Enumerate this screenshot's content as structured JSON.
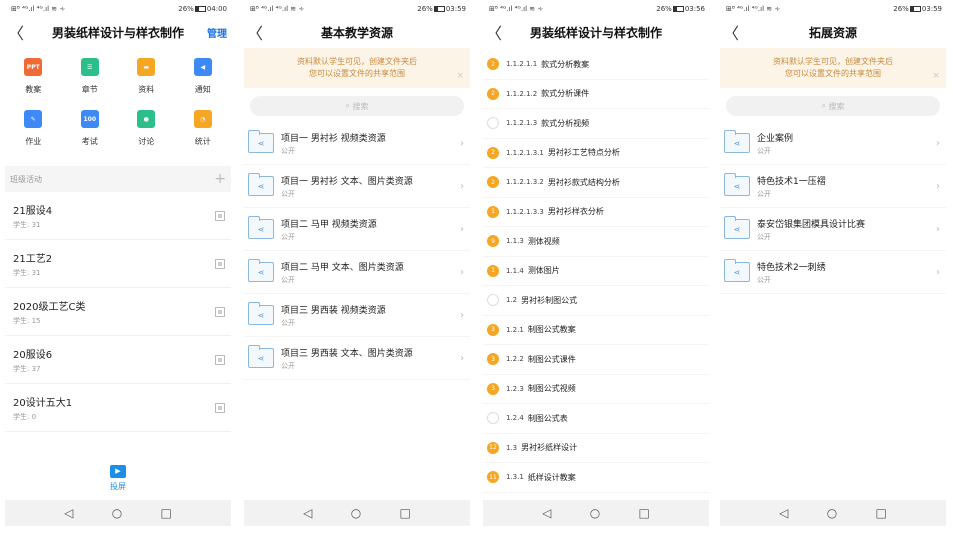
{
  "colors": {
    "accent": "#1a73e8",
    "orange": "#f5a623",
    "notice_text": "#c88a3c",
    "notice_bg": "#fdf4e8"
  },
  "status": {
    "p1": {
      "left": "⊞ᴮ ⁴ᴳ.ıl ⁴ᴳ.ıl ≋ ∻",
      "battery": "26%",
      "time": "04:00"
    },
    "p2": {
      "left": "⊞ᴮ ⁴ᴳ.ıl ⁴ᴳ.ıl ≋ ∻",
      "battery": "26%",
      "time": "03:59"
    },
    "p3": {
      "left": "⊞ᴮ ⁴ᴳ.ıl ⁴ᴳ.ıl ≋ ∻",
      "battery": "26%",
      "time": "03:56"
    },
    "p4": {
      "left": "⊞ᴮ ⁴ᴳ.ıl ⁴ᴳ.ıl ≋ ∻",
      "battery": "26%",
      "time": "03:59"
    }
  },
  "screen1": {
    "title": "男装纸样设计与样衣制作",
    "manage": "管理",
    "tools": [
      {
        "label": "教案",
        "icon": "ppt-icon",
        "color": "#f06a35",
        "glyph": "PPT"
      },
      {
        "label": "章节",
        "icon": "list-icon",
        "color": "#2bbf8a",
        "glyph": "☰"
      },
      {
        "label": "资料",
        "icon": "folder-icon",
        "color": "#f5a623",
        "glyph": "▬"
      },
      {
        "label": "通知",
        "icon": "megaphone-icon",
        "color": "#3d8af7",
        "glyph": "◀"
      },
      {
        "label": "作业",
        "icon": "homework-icon",
        "color": "#3d8af7",
        "glyph": "✎"
      },
      {
        "label": "考试",
        "icon": "exam-icon",
        "color": "#3d8af7",
        "glyph": "100"
      },
      {
        "label": "讨论",
        "icon": "chat-icon",
        "color": "#2bbf8a",
        "glyph": "●"
      },
      {
        "label": "统计",
        "icon": "pie-chart-icon",
        "color": "#f5a623",
        "glyph": "◔"
      }
    ],
    "section": "班级活动",
    "plus": "+",
    "classes": [
      {
        "name": "21服设4",
        "students": "学生: 31"
      },
      {
        "name": "21工艺2",
        "students": "学生: 31"
      },
      {
        "name": "2020级工艺C类",
        "students": "学生: 15"
      },
      {
        "name": "20服设6",
        "students": "学生: 37"
      },
      {
        "name": "20设计五大1",
        "students": "学生: 0"
      }
    ],
    "tab_label": "投屏"
  },
  "screen2": {
    "title": "基本教学资源",
    "notice_line1": "资料默认学生可见，创建文件夹后",
    "notice_line2": "您可以设置文件的共享范围",
    "search": "搜索",
    "folders": [
      {
        "name": "项目一 男衬衫 视频类资源",
        "sub": "公开"
      },
      {
        "name": "项目一  男衬衫 文本、图片类资源",
        "sub": "公开"
      },
      {
        "name": "项目二 马甲 视频类资源",
        "sub": "公开"
      },
      {
        "name": "项目二 马甲   文本、图片类资源",
        "sub": "公开"
      },
      {
        "name": "项目三 男西装 视频类资源",
        "sub": "公开"
      },
      {
        "name": "项目三  男西装 文本、图片类资源",
        "sub": "公开"
      }
    ]
  },
  "screen3": {
    "title": "男装纸样设计与样衣制作",
    "chapters": [
      {
        "badge": "2",
        "color": "#f5a623",
        "num": "1.1.2.1.1",
        "title": "款式分析教案"
      },
      {
        "badge": "2",
        "color": "#f5a623",
        "num": "1.1.2.1.2",
        "title": "款式分析课件"
      },
      {
        "badge": "",
        "color": "",
        "num": "1.1.2.1.3",
        "title": "款式分析视频"
      },
      {
        "badge": "2",
        "color": "#f5a623",
        "num": "1.1.2.1.3.1",
        "title": "男衬衫工艺特点分析"
      },
      {
        "badge": "2",
        "color": "#f5a623",
        "num": "1.1.2.1.3.2",
        "title": "男衬衫款式结构分析"
      },
      {
        "badge": "1",
        "color": "#f5a623",
        "num": "1.1.2.1.3.3",
        "title": "男衬衫样衣分析"
      },
      {
        "badge": "9",
        "color": "#f5a623",
        "num": "1.1.3",
        "title": "测体视频"
      },
      {
        "badge": "1",
        "color": "#f5a623",
        "num": "1.1.4",
        "title": "测体图片"
      },
      {
        "badge": "",
        "color": "",
        "num": "1.2",
        "title": "男衬衫制图公式"
      },
      {
        "badge": "3",
        "color": "#f5a623",
        "num": "1.2.1",
        "title": "制图公式教案"
      },
      {
        "badge": "3",
        "color": "#f5a623",
        "num": "1.2.2",
        "title": "制图公式课件"
      },
      {
        "badge": "3",
        "color": "#f5a623",
        "num": "1.2.3",
        "title": "制图公式视频"
      },
      {
        "badge": "",
        "color": "",
        "num": "1.2.4",
        "title": "制图公式表"
      },
      {
        "badge": "12",
        "color": "#f5a623",
        "num": "1.3",
        "title": "男衬衫纸样设计"
      },
      {
        "badge": "11",
        "color": "#f5a623",
        "num": "1.3.1",
        "title": "纸样设计教案"
      }
    ]
  },
  "screen4": {
    "title": "拓展资源",
    "notice_line1": "资料默认学生可见，创建文件夹后",
    "notice_line2": "您可以设置文件的共享范围",
    "search": "搜索",
    "folders": [
      {
        "name": "企业案例",
        "sub": "公开"
      },
      {
        "name": "特色技术1一压褶",
        "sub": "公开"
      },
      {
        "name": "泰安岱银集团模具设计比赛",
        "sub": "公开"
      },
      {
        "name": "特色技术2一刺绣",
        "sub": "公开"
      }
    ]
  },
  "nav": {
    "back": "◁",
    "home": "○",
    "recent": "□"
  },
  "glyphs": {
    "back_arrow": "〈",
    "chevron": "›",
    "close": "×",
    "share": "⋖",
    "search": "⌕"
  }
}
